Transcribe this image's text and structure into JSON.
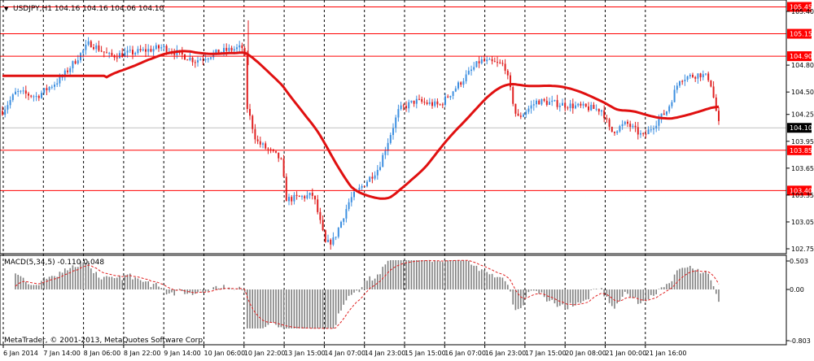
{
  "main_chart": {
    "header_text": "USDJPY,H1  104.16 104.16 104.06 104.10",
    "symbol_glyph": "▼",
    "price_ticks": [
      "105.40",
      "104.80",
      "104.50",
      "104.25",
      "103.95",
      "103.65",
      "103.35",
      "103.05",
      "102.75"
    ],
    "current_price": "104.10",
    "level_lines": [
      "105.45",
      "105.15",
      "104.90",
      "103.85",
      "103.40"
    ],
    "colors": {
      "bull": "#3d8fe0",
      "bear": "#e02020",
      "ma": "#e01010",
      "level_line": "#ff0000",
      "level_label_bg": "#ff0000",
      "current_label_bg": "#000000",
      "axis_text": "#000000"
    }
  },
  "indicator": {
    "header_text": "MACD(5,34,5) -0.110 0.048",
    "ticks": [
      "0.503",
      "0.00",
      "-0.803"
    ]
  },
  "time_labels": [
    "6 Jan 2014",
    "7 Jan 14:00",
    "8 Jan 06:00",
    "8 Jan 22:00",
    "9 Jan 14:00",
    "10 Jan 06:00",
    "10 Jan 22:00",
    "13 Jan 15:00",
    "14 Jan 07:00",
    "14 Jan 23:00",
    "15 Jan 15:00",
    "16 Jan 07:00",
    "16 Jan 23:00",
    "17 Jan 15:00",
    "20 Jan 08:00",
    "21 Jan 00:00",
    "21 Jan 16:00"
  ],
  "copyright": "MetaTrader, © 2001-2013, MetaQuotes Software Corp."
}
